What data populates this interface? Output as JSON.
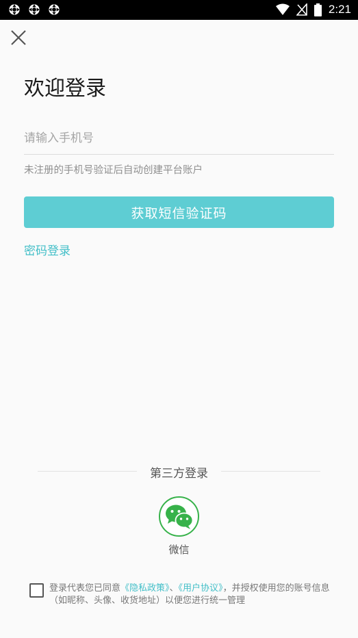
{
  "status_bar": {
    "time": "2:21",
    "left_icons": [
      "app-notification-icon",
      "app-notification-icon",
      "app-notification-icon"
    ],
    "right_icons": [
      "wifi-icon",
      "no-signal-icon",
      "battery-icon"
    ]
  },
  "page": {
    "title": "欢迎登录",
    "phone_placeholder": "请输入手机号",
    "phone_value": "",
    "hint": "未注册的手机号验证后自动创建平台账户",
    "sms_button": "获取短信验证码",
    "password_login": "密码登录"
  },
  "third_party": {
    "title": "第三方登录",
    "wechat_label": "微信"
  },
  "agreement": {
    "prefix": "登录代表您已同意",
    "privacy_link": "《隐私政策》",
    "separator": "、",
    "user_link": "《用户协议》",
    "suffix": "，并授权使用您的账号信息（如昵称、头像、收货地址）以便您进行统一管理",
    "checked": false
  },
  "colors": {
    "accent": "#5ecdd3",
    "link": "#43bfc8",
    "wechat_green": "#37b24a",
    "background": "#fafafa"
  }
}
